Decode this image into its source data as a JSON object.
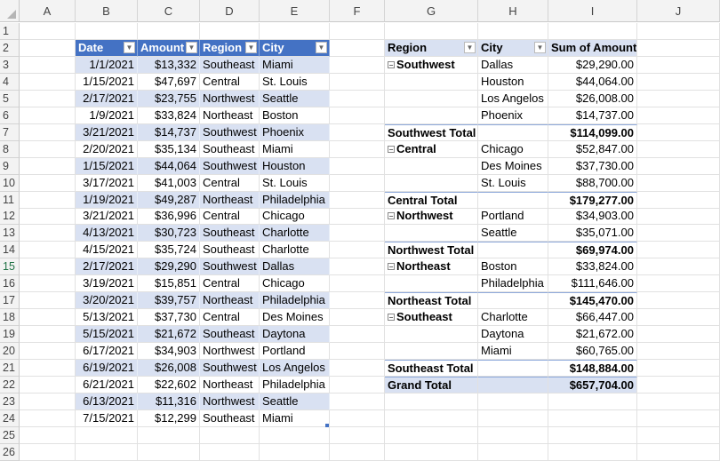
{
  "columns": [
    "A",
    "B",
    "C",
    "D",
    "E",
    "F",
    "G",
    "H",
    "I",
    "J"
  ],
  "active_row": 15,
  "source_table": {
    "headers": [
      "Date",
      "Amount",
      "Region",
      "City"
    ],
    "rows": [
      [
        "1/1/2021",
        "$13,332",
        "Southeast",
        "Miami"
      ],
      [
        "1/15/2021",
        "$47,697",
        "Central",
        "St. Louis"
      ],
      [
        "2/17/2021",
        "$23,755",
        "Northwest",
        "Seattle"
      ],
      [
        "1/9/2021",
        "$33,824",
        "Northeast",
        "Boston"
      ],
      [
        "3/21/2021",
        "$14,737",
        "Southwest",
        "Phoenix"
      ],
      [
        "2/20/2021",
        "$35,134",
        "Southeast",
        "Miami"
      ],
      [
        "1/15/2021",
        "$44,064",
        "Southwest",
        "Houston"
      ],
      [
        "3/17/2021",
        "$41,003",
        "Central",
        "St. Louis"
      ],
      [
        "1/19/2021",
        "$49,287",
        "Northeast",
        "Philadelphia"
      ],
      [
        "3/21/2021",
        "$36,996",
        "Central",
        "Chicago"
      ],
      [
        "4/13/2021",
        "$30,723",
        "Southeast",
        "Charlotte"
      ],
      [
        "4/15/2021",
        "$35,724",
        "Southeast",
        "Charlotte"
      ],
      [
        "2/17/2021",
        "$29,290",
        "Southwest",
        "Dallas"
      ],
      [
        "3/19/2021",
        "$15,851",
        "Central",
        "Chicago"
      ],
      [
        "3/20/2021",
        "$39,757",
        "Northeast",
        "Philadelphia"
      ],
      [
        "5/13/2021",
        "$37,730",
        "Central",
        "Des Moines"
      ],
      [
        "5/15/2021",
        "$21,672",
        "Southeast",
        "Daytona"
      ],
      [
        "6/17/2021",
        "$34,903",
        "Northwest",
        "Portland"
      ],
      [
        "6/19/2021",
        "$26,008",
        "Southwest",
        "Los Angelos"
      ],
      [
        "6/21/2021",
        "$22,602",
        "Northeast",
        "Philadelphia"
      ],
      [
        "6/13/2021",
        "$11,316",
        "Northwest",
        "Seattle"
      ],
      [
        "7/15/2021",
        "$12,299",
        "Southeast",
        "Miami"
      ]
    ]
  },
  "pivot": {
    "headers": [
      "Region",
      "City",
      "Sum of Amount"
    ],
    "rows": [
      {
        "type": "group",
        "region": "Southwest",
        "city": "Dallas",
        "amount": "$29,290.00"
      },
      {
        "type": "item",
        "city": "Houston",
        "amount": "$44,064.00"
      },
      {
        "type": "item",
        "city": "Los Angelos",
        "amount": "$26,008.00"
      },
      {
        "type": "item",
        "city": "Phoenix",
        "amount": "$14,737.00"
      },
      {
        "type": "total",
        "region": "Southwest Total",
        "amount": "$114,099.00"
      },
      {
        "type": "group",
        "region": "Central",
        "city": "Chicago",
        "amount": "$52,847.00"
      },
      {
        "type": "item",
        "city": "Des Moines",
        "amount": "$37,730.00"
      },
      {
        "type": "item",
        "city": "St. Louis",
        "amount": "$88,700.00"
      },
      {
        "type": "total",
        "region": "Central Total",
        "amount": "$179,277.00"
      },
      {
        "type": "group",
        "region": "Northwest",
        "city": "Portland",
        "amount": "$34,903.00"
      },
      {
        "type": "item",
        "city": "Seattle",
        "amount": "$35,071.00"
      },
      {
        "type": "total",
        "region": "Northwest Total",
        "amount": "$69,974.00"
      },
      {
        "type": "group",
        "region": "Northeast",
        "city": "Boston",
        "amount": "$33,824.00"
      },
      {
        "type": "item",
        "city": "Philadelphia",
        "amount": "$111,646.00"
      },
      {
        "type": "total",
        "region": "Northeast Total",
        "amount": "$145,470.00"
      },
      {
        "type": "group",
        "region": "Southeast",
        "city": "Charlotte",
        "amount": "$66,447.00"
      },
      {
        "type": "item",
        "city": "Daytona",
        "amount": "$21,672.00"
      },
      {
        "type": "item",
        "city": "Miami",
        "amount": "$60,765.00"
      },
      {
        "type": "total",
        "region": "Southeast Total",
        "amount": "$148,884.00"
      },
      {
        "type": "grand",
        "region": "Grand Total",
        "amount": "$657,704.00"
      }
    ]
  }
}
